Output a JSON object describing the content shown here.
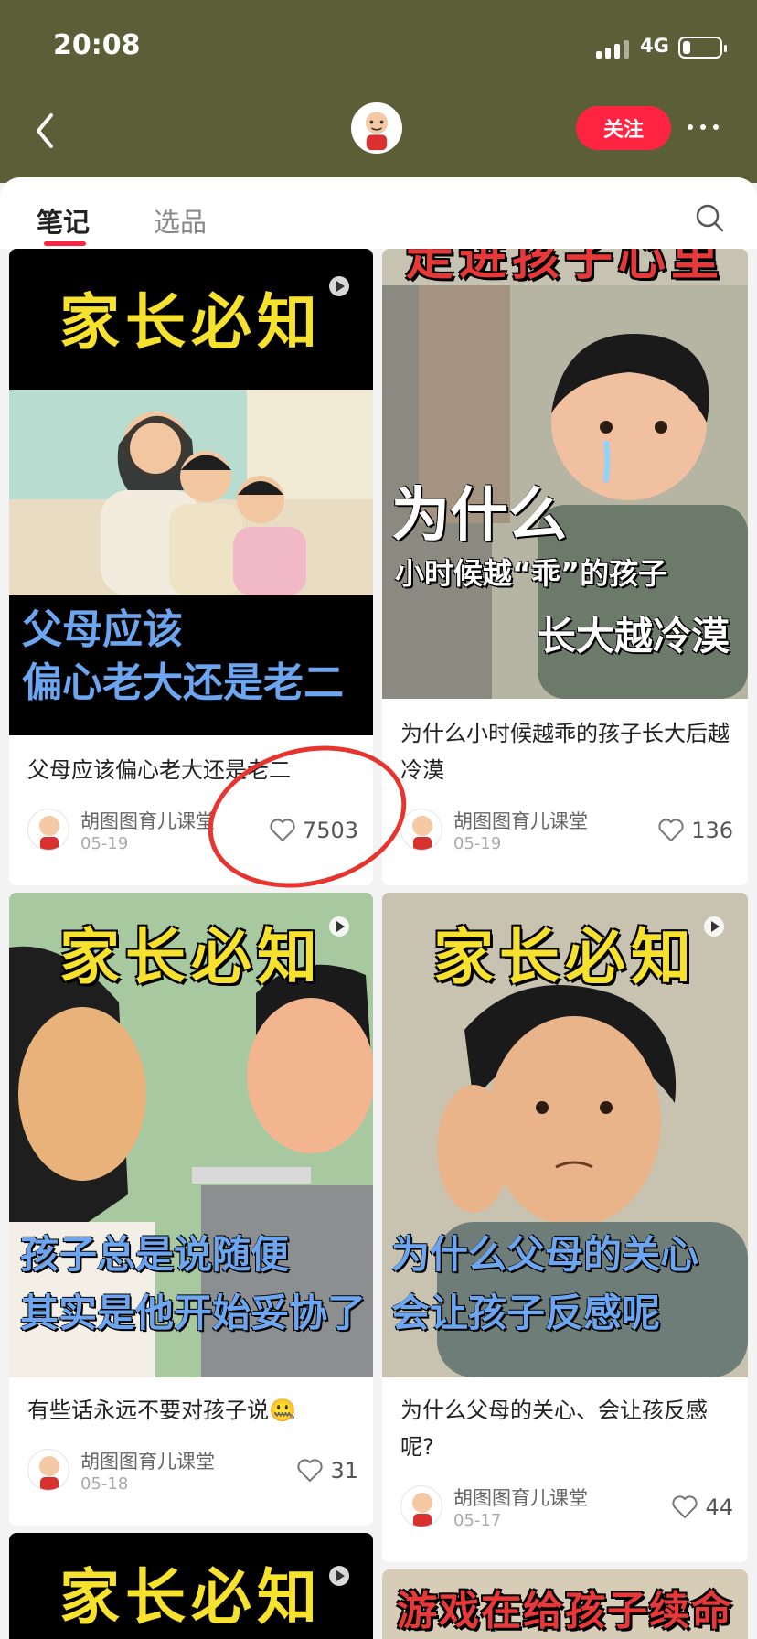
{
  "status_bar": {
    "time": "20:08",
    "network": "4G"
  },
  "header": {
    "follow_label": "关注"
  },
  "tabs": [
    {
      "label": "笔记",
      "active": true
    },
    {
      "label": "选品",
      "active": false
    }
  ],
  "accent_color": "#ff2442",
  "header_color": "#5b5e37",
  "cards": [
    {
      "banner": "家长必知",
      "caption_lines": [
        "父母应该",
        "偏心老大还是老二"
      ],
      "title": "父母应该偏心老大还是老二",
      "author": "胡图图育儿课堂",
      "date": "05-19",
      "likes": "7503"
    },
    {
      "banner": "走进孩子心里",
      "caption_lines": [
        "为什么",
        "小时候越“乖”的孩子",
        "长大越冷漠"
      ],
      "title": "为什么小时候越乖的孩子长大后越冷漠",
      "author": "胡图图育儿课堂",
      "date": "05-19",
      "likes": "136"
    },
    {
      "banner": "家长必知",
      "caption_lines": [
        "孩子总是说随便",
        "其实是他开始妥协了"
      ],
      "title": "有些话永远不要对孩子说🤐",
      "author": "胡图图育儿课堂",
      "date": "05-18",
      "likes": "31"
    },
    {
      "banner": "家长必知",
      "caption_lines": [
        "为什么父母的关心",
        "会让孩子反感呢"
      ],
      "title": "为什么父母的关心、会让孩反感呢?",
      "author": "胡图图育儿课堂",
      "date": "05-17",
      "likes": "44"
    },
    {
      "banner": "家长必知"
    },
    {
      "banner": "游戏在给孩子续命"
    }
  ]
}
